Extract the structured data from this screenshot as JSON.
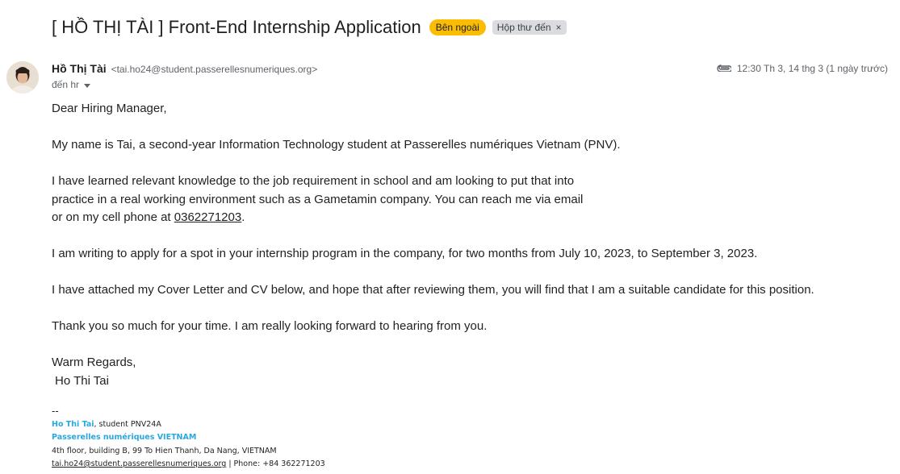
{
  "email": {
    "subject": "[ HỒ THỊ TÀI ] Front-End Internship Application",
    "labels": {
      "external": "Bên ngoài",
      "inbox": "Hộp thư đến",
      "inbox_remove": "×"
    },
    "sender": {
      "name": "Hồ Thị Tài",
      "email": "<tai.ho24@student.passerellesnumeriques.org>"
    },
    "to": "đến hr",
    "timestamp": "12:30 Th 3, 14 thg 3 (1 ngày trước)",
    "body": {
      "greeting": "Dear Hiring Manager,",
      "intro": "My name is Tai, a second-year Information Technology student at Passerelles numériques Vietnam (PNV).",
      "para2_line1": "I have learned relevant knowledge to the job requirement in school and am looking to put that into",
      "para2_line2": "practice in a real working environment such as a Gametamin company. You can reach me via email",
      "para2_line3_prefix": "or on my cell phone at ",
      "phone": "0362271203",
      "para2_line3_suffix": ".",
      "para3": "I am writing to apply for a spot in your internship program in the company, for two months from July 10, 2023, to September 3, 2023.",
      "para4": "I have attached my Cover Letter and CV below, and hope that after reviewing them, you will find that I am a suitable candidate for this position.",
      "para5": "Thank you so much for your time. I am really looking forward to hearing from you.",
      "closing": "Warm Regards,",
      "signoff_name": "Ho Thi Tai"
    },
    "signature": {
      "dash": "--",
      "name": "Ho Thi Tai",
      "role": ", student PNV24A",
      "org": "Passerelles numériques VIETNAM",
      "address": "4th floor, building B, 99 To Hien Thanh, Da Nang, VIETNAM",
      "email": "tai.ho24@student.passerellesnumeriques.org",
      "phone_text": " | Phone: +84 362271203"
    }
  },
  "colors": {
    "external_badge": "#fbbc04",
    "inbox_badge": "#dadce0",
    "signature_blue": "#29a8e0"
  }
}
